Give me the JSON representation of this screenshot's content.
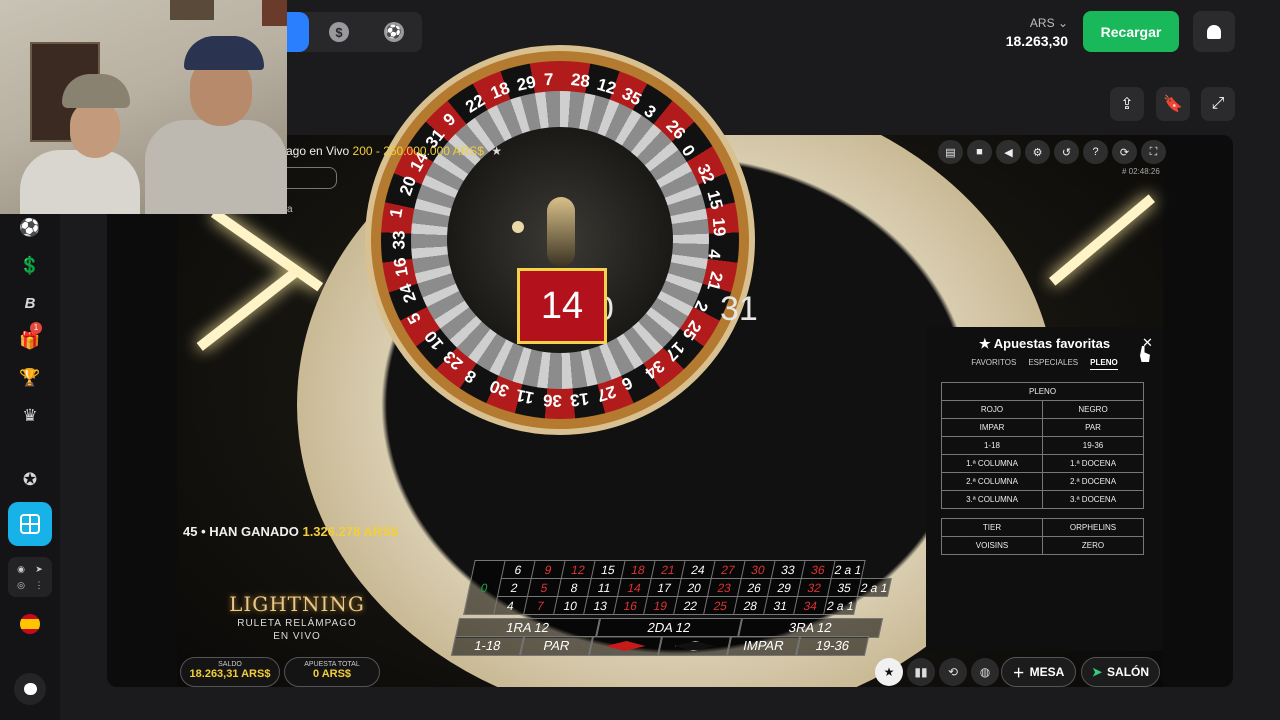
{
  "topbar": {
    "currency_code": "ARS",
    "balance": "18.263,30",
    "recharge_label": "Recargar"
  },
  "game": {
    "title_prefix": "ago en Vivo",
    "bet_range": "200 - 250.000.000 ARS$",
    "game_id": "# 02:48:26",
    "side_letter": "a",
    "result_number": "14",
    "neighbor_left": "20",
    "neighbor_right": "31",
    "winners_count": "45",
    "winners_label": "HAN GANADO",
    "winners_amount": "1.326.278 ARS$",
    "logo_line1": "LIGHTNING",
    "logo_line2": "RULETA RELÁMPAGO",
    "logo_line3": "EN VIVO",
    "balance_label": "SALDO",
    "balance_value": "18.263,31 ARS$",
    "total_bet_label": "APUESTA TOTAL",
    "total_bet_value": "0 ARS$",
    "mesa_label": "MESA",
    "salon_label": "SALÓN"
  },
  "wheel_numbers": [
    "22",
    "18",
    "29",
    "7",
    "28",
    "12",
    "35",
    "3",
    "26",
    "0",
    "32",
    "15",
    "19",
    "4",
    "21",
    "2",
    "25",
    "17",
    "34",
    "6",
    "27",
    "13",
    "36",
    "11",
    "30",
    "8",
    "23",
    "10",
    "5",
    "24",
    "16",
    "33",
    "1",
    "20",
    "14",
    "31",
    "9"
  ],
  "bet_grid": {
    "row3": [
      "6",
      "9",
      "12",
      "15",
      "18",
      "21",
      "24",
      "27",
      "30",
      "33",
      "36",
      "2 a 1"
    ],
    "row2": [
      "2",
      "5",
      "8",
      "11",
      "14",
      "17",
      "20",
      "23",
      "26",
      "29",
      "32",
      "35",
      "2 a 1"
    ],
    "row1": [
      "4",
      "7",
      "10",
      "13",
      "16",
      "19",
      "22",
      "25",
      "28",
      "31",
      "34",
      "2 a 1"
    ],
    "zero": "0",
    "dozens": [
      "1RA 12",
      "2DA 12",
      "3RA 12"
    ],
    "outside": [
      "1-18",
      "PAR",
      "",
      "",
      "IMPAR",
      "19-36"
    ]
  },
  "favorites": {
    "title": "Apuestas favoritas",
    "tabs": [
      "FAVORITOS",
      "ESPECIALES",
      "PLENO"
    ],
    "header": "PLENO",
    "rows": [
      [
        "ROJO",
        "NEGRO"
      ],
      [
        "IMPAR",
        "PAR"
      ],
      [
        "1-18",
        "19-36"
      ],
      [
        "1.ª COLUMNA",
        "1.ª DOCENA"
      ],
      [
        "2.ª COLUMNA",
        "2.ª DOCENA"
      ],
      [
        "3.ª COLUMNA",
        "3.ª DOCENA"
      ]
    ],
    "special_rows": [
      [
        "TIER",
        "ORPHELINS"
      ],
      [
        "VOISINS",
        "ZERO"
      ]
    ]
  },
  "colors": {
    "accent_blue": "#2a7fff",
    "recharge_green": "#19b85a",
    "gold": "#f2cf3a",
    "roulette_red": "#b3121c"
  }
}
